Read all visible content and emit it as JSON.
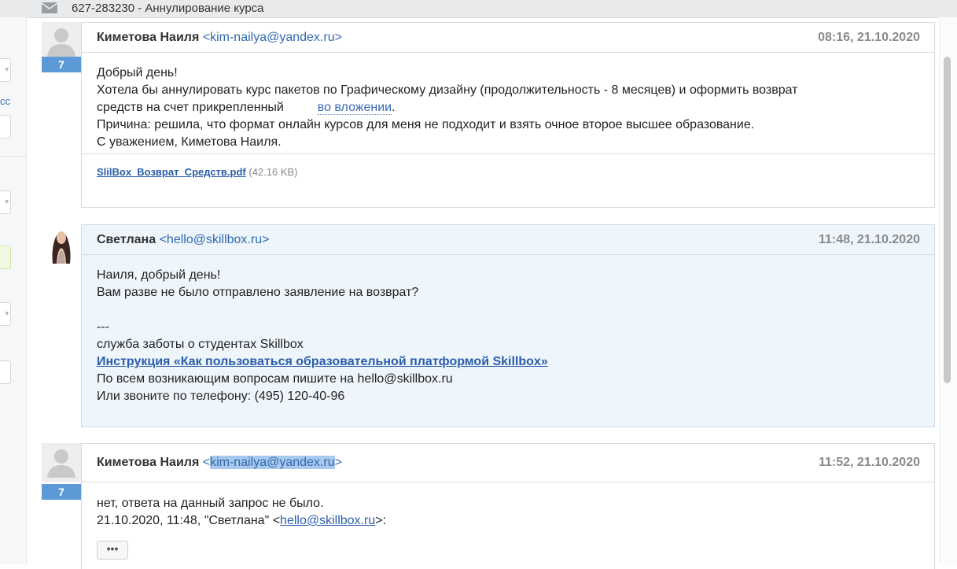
{
  "topbar": {
    "title": "627-283230 - Аннулирование курса",
    "icon": "envelope-icon"
  },
  "leftstrip": {
    "partial_text": "сс"
  },
  "messages": [
    {
      "author": "Киметова Наиля",
      "email": "<kim-nailya@yandex.ru>",
      "date": "08:16, 21.10.2020",
      "badge": "7",
      "lines": {
        "l1": "Добрый день!",
        "l2": "Хотела бы аннулировать курс пакетов по Графическому дизайну (продолжительность - 8 месяцев) и оформить возврат",
        "l3a": "средств на счет прикрепленный",
        "l3b": "во вложении",
        "l3c": ".",
        "l4": "Причина: решила, что формат онлайн курсов для меня не подходит и взять очное второе высшее образование.",
        "l5": "С уважением, Киметова Наиля."
      },
      "attachment": {
        "filename": "SlilBox_Возврат_Средств.pdf",
        "size": "(42.16 KB)"
      }
    },
    {
      "author": "Светлана",
      "email": "<hello@skillbox.ru>",
      "date": "11:48, 21.10.2020",
      "lines": {
        "l1": "Наиля, добрый день!",
        "l2": "Вам разве не было отправлено заявление на возврат?",
        "l3": "---",
        "l4": "служба заботы о студентах Skillbox",
        "l5": "Инструкция «Как пользоваться образовательной платформой Skillbox»",
        "l6": "По всем возникающим вопросам пишите на hello@skillbox.ru",
        "l7": "Или звоните по телефону: (495) 120-40-96"
      }
    },
    {
      "author": "Киметова Наиля",
      "email_prefix": "<",
      "email_selected": "kim-nailya@yandex.ru",
      "email_suffix": ">",
      "date": "11:52, 21.10.2020",
      "badge": "7",
      "lines": {
        "l1": "нет, ответа на данный запрос не было.",
        "l2a": "21.10.2020, 11:48, \"Светлана\" <",
        "l2b": "hello@skillbox.ru",
        "l2c": ">:"
      },
      "more_button": "•••"
    }
  ],
  "colors": {
    "badge": "#5b9ad6",
    "link": "#2a5da8",
    "staff_message_bg": "#eef5fb",
    "selection": "#a8c8ee"
  }
}
